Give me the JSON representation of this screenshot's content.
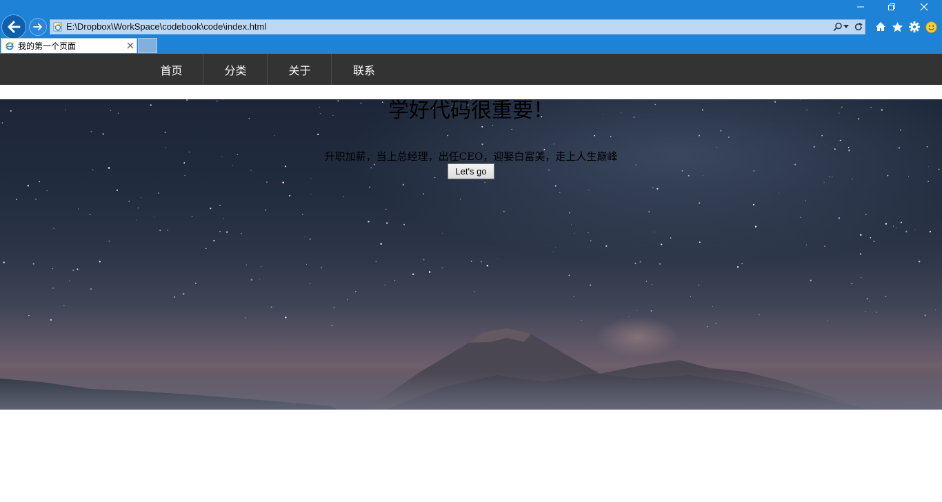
{
  "browser": {
    "address": "E:\\Dropbox\\WorkSpace\\codebook\\code\\index.html",
    "tab_title": "我的第一个页面",
    "accent": "#1e82d6"
  },
  "nav": {
    "items": [
      "首页",
      "分类",
      "关于",
      "联系"
    ]
  },
  "hero": {
    "title": "学好代码很重要！",
    "subtitle": "升职加薪，当上总经理，出任CEO，迎娶白富美，走上人生巅峰",
    "button_label": "Let's go"
  }
}
